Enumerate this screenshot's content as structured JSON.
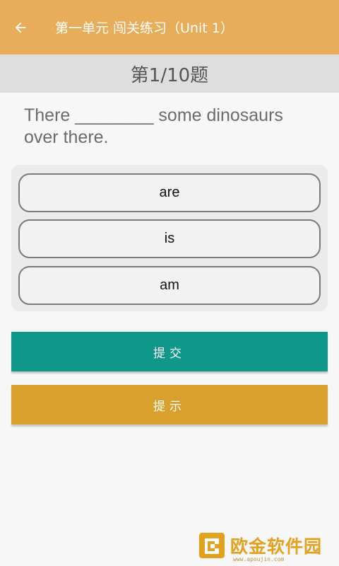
{
  "appbar": {
    "title": "第一单元 闯关练习（Unit 1）",
    "back_icon": "arrow-left-icon",
    "color": "#e8ad5a"
  },
  "progress": {
    "counter_text": "第1/10题"
  },
  "question": {
    "text": "There ________ some dinosaurs over there."
  },
  "options": [
    {
      "label": "are"
    },
    {
      "label": "is"
    },
    {
      "label": "am"
    }
  ],
  "buttons": {
    "submit_label": "提交",
    "submit_color": "#0f978a",
    "hint_label": "提示",
    "hint_color": "#d9a02e"
  },
  "watermark": {
    "text": "欧金软件园",
    "url": "www.apoujin.com"
  }
}
